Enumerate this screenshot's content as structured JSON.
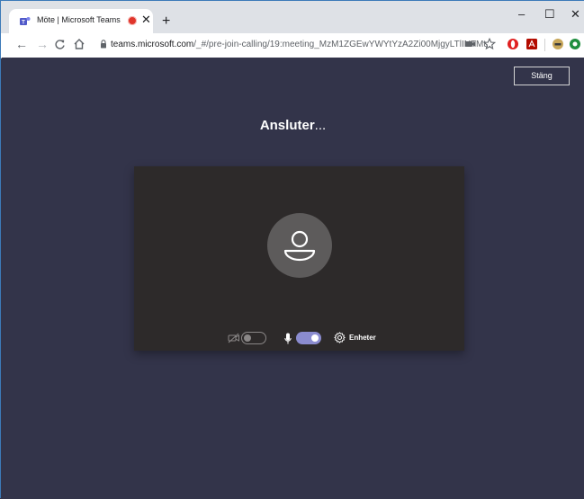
{
  "browser": {
    "tab_title": "Möte | Microsoft Teams",
    "tab_close": "✕",
    "new_tab": "+",
    "window_controls": {
      "minimize": "–",
      "maximize": "☐",
      "close": "✕"
    },
    "nav": {
      "back": "←",
      "forward": "→",
      "reload": "C",
      "home": "⌂"
    },
    "url_host": "teams.microsoft.com",
    "url_path": "/_#/pre-join-calling/19:meeting_MzM1ZGEwYWYtYzA2Zi00MjgyLTlINTMt...",
    "extension_icons": [
      "camera-icon",
      "star-icon",
      "opera-icon",
      "acrobat-icon",
      "extension-icon",
      "green-extension-icon"
    ]
  },
  "meeting": {
    "close_label": "Stäng",
    "status_text": "Ansluter",
    "status_dots": "...",
    "devices_label": "Enheter",
    "camera_on": false,
    "mic_on": true
  },
  "colors": {
    "background": "#33344a",
    "preview": "#2d2a2a",
    "toggle_on": "#8b8ccf"
  }
}
